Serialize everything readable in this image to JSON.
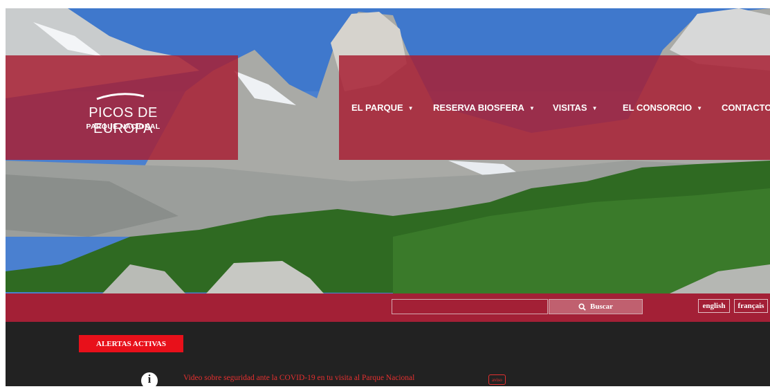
{
  "logo": {
    "title": "PICOS DE EUROPA",
    "subtitle": "PARQUE NACIONAL"
  },
  "nav": [
    {
      "label": "EL PARQUE",
      "has_dropdown": true
    },
    {
      "label": "RESERVA BIOSFERA",
      "has_dropdown": true
    },
    {
      "label": "VISITAS",
      "has_dropdown": true
    },
    {
      "label": "EL CONSORCIO",
      "has_dropdown": true
    },
    {
      "label": "CONTACTO",
      "has_dropdown": false
    }
  ],
  "search": {
    "placeholder": "",
    "value": "",
    "button_label": "Buscar",
    "icon": "search-icon"
  },
  "languages": [
    "english",
    "français"
  ],
  "alerts": {
    "heading": "ALERTAS ACTIVAS",
    "items": [
      {
        "text": "Video sobre seguridad ante la COVID-19 en tu visita al Parque Nacional",
        "tag": "aviso",
        "icon": "info-icon"
      }
    ]
  },
  "colors": {
    "brand": "#a32036",
    "alert_red": "#e8101a",
    "dark_bg": "#222222"
  }
}
